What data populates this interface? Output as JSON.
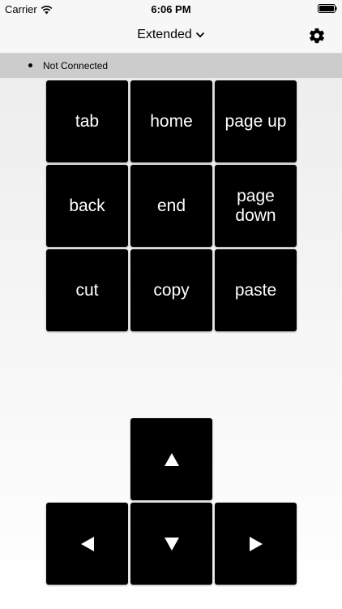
{
  "status_bar": {
    "carrier": "Carrier",
    "time": "6:06 PM",
    "icons": [
      "wifi-icon",
      "battery-icon"
    ]
  },
  "nav": {
    "title": "Extended",
    "title_icon": "chevron-down-icon",
    "settings_icon": "gear-icon"
  },
  "connection": {
    "status": "Not Connected"
  },
  "keypad": {
    "keys": [
      {
        "label": "tab"
      },
      {
        "label": "home"
      },
      {
        "label": "page up"
      },
      {
        "label": "back"
      },
      {
        "label": "end"
      },
      {
        "label": "page\ndown"
      },
      {
        "label": "cut"
      },
      {
        "label": "copy"
      },
      {
        "label": "paste"
      }
    ]
  },
  "arrows": {
    "up": "arrow-up-icon",
    "left": "arrow-left-icon",
    "down": "arrow-down-icon",
    "right": "arrow-right-icon"
  },
  "colors": {
    "key_bg": "#000000",
    "key_text": "#ffffff",
    "conn_bar": "#cccccc",
    "nav_bg": "#f7f7f7"
  }
}
